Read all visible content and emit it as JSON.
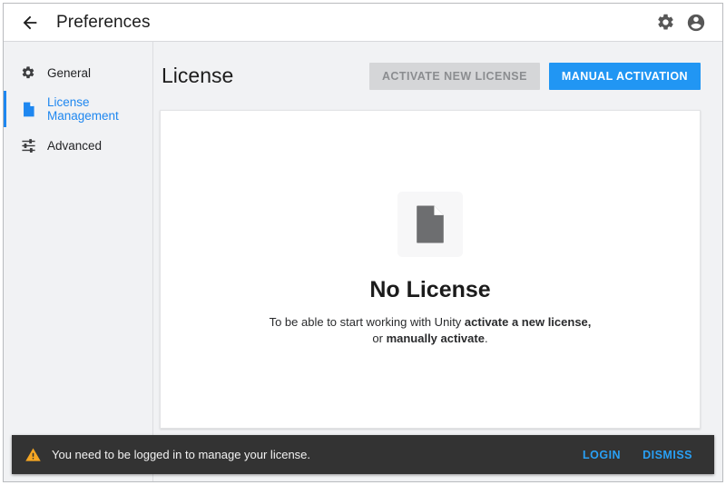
{
  "window": {
    "header": {
      "back_icon": "arrow-back-icon",
      "title": "Preferences",
      "settings_icon": "gear-icon",
      "account_icon": "account-circle-icon"
    }
  },
  "sidebar": {
    "items": [
      {
        "label": "General",
        "icon": "gear-icon",
        "selected": false
      },
      {
        "label": "License Management",
        "icon": "document-icon",
        "selected": true
      },
      {
        "label": "Advanced",
        "icon": "tune-icon",
        "selected": false
      }
    ]
  },
  "main": {
    "title": "License",
    "buttons": {
      "activate_new": "ACTIVATE NEW LICENSE",
      "manual_activation": "MANUAL ACTIVATION"
    },
    "empty_state": {
      "icon": "document-icon",
      "title": "No License",
      "description_line1_prefix": "To be able to start working with Unity ",
      "description_line1_bold": "activate a new license,",
      "description_line2_prefix": "or ",
      "description_line2_bold": "manually activate",
      "description_line2_suffix": "."
    }
  },
  "toast": {
    "icon": "warning-triangle-icon",
    "message": "You need to be logged in to manage your license.",
    "actions": [
      "LOGIN",
      "DISMISS"
    ]
  },
  "colors": {
    "accent_blue": "#2196f3",
    "link_blue": "#1e87f0",
    "toast_link": "#29a0f5",
    "warning_orange": "#f5a623",
    "toast_bg": "#333333",
    "page_bg": "#f1f2f4"
  }
}
